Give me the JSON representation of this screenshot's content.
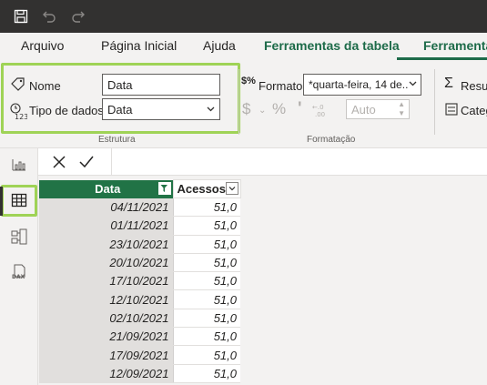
{
  "menu": {
    "items": [
      "Arquivo",
      "Página Inicial",
      "Ajuda",
      "Ferramentas da tabela",
      "Ferramentas"
    ]
  },
  "ribbon": {
    "name_label": "Nome",
    "name_value": "Data",
    "datatype_label": "Tipo de dados",
    "datatype_value": "Data",
    "group_estrutura": "Estrutura",
    "format_label": "Formato",
    "format_value": "*quarta-feira, 14 de...",
    "percent_symbol": "%",
    "comma_symbol": "'",
    "auto_value": "Auto",
    "group_formatacao": "Formatação",
    "resumo_label": "Resum",
    "categ_label": "Categ"
  },
  "table": {
    "headers": [
      "Data",
      "Acessos"
    ],
    "rows": [
      [
        "04/11/2021",
        "51,0"
      ],
      [
        "01/11/2021",
        "51,0"
      ],
      [
        "23/10/2021",
        "51,0"
      ],
      [
        "20/10/2021",
        "51,0"
      ],
      [
        "17/10/2021",
        "51,0"
      ],
      [
        "12/10/2021",
        "51,0"
      ],
      [
        "02/10/2021",
        "51,0"
      ],
      [
        "21/09/2021",
        "51,0"
      ],
      [
        "17/09/2021",
        "51,0"
      ],
      [
        "12/09/2021",
        "51,0"
      ]
    ]
  },
  "colors": {
    "accent_green": "#217346",
    "highlight_green": "#9fd356",
    "titlebar": "#323130"
  },
  "icons": [
    "save-icon",
    "undo-icon",
    "redo-icon",
    "tag-icon",
    "datatype-icon",
    "format-icon",
    "currency-icon",
    "percent-icon",
    "comma-icon",
    "decimal-icon",
    "sigma-icon",
    "category-icon",
    "report-view-icon",
    "table-view-icon",
    "model-view-icon",
    "dax-query-icon",
    "cancel-icon",
    "commit-icon",
    "filter-icon",
    "dropdown-icon"
  ]
}
